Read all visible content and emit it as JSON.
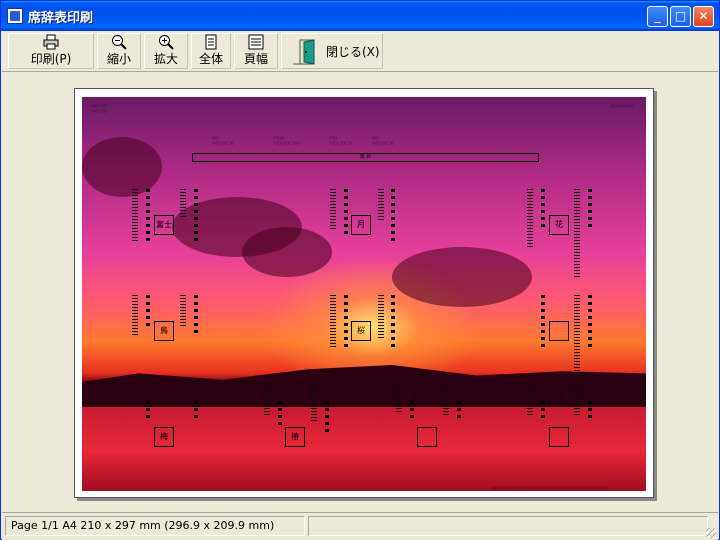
{
  "window": {
    "title": "席辞表印刷"
  },
  "titlebar": {
    "min_glyph": "_",
    "max_glyph": "□",
    "close_glyph": "✕"
  },
  "toolbar": {
    "print_label": "印刷(P)",
    "zoom_out_label": "縮小",
    "zoom_in_label": "拡大",
    "whole_label": "全体",
    "page_width_label": "頁幅",
    "close_label": "閉じる(X)",
    "print_icon": "printer-icon",
    "zoom_out_icon": "magnifier-minus-icon",
    "zoom_in_icon": "magnifier-plus-icon",
    "whole_icon": "page-icon",
    "page_width_icon": "page-lines-icon",
    "close_icon": "door-exit-icon"
  },
  "preview": {
    "head_table_label": "高 砂",
    "tables": [
      {
        "name": "富士"
      },
      {
        "name": "月"
      },
      {
        "name": "花"
      },
      {
        "name": "鳥"
      },
      {
        "name": "桜"
      },
      {
        "name": ""
      },
      {
        "name": "梅"
      },
      {
        "name": "椿"
      },
      {
        "name": ""
      },
      {
        "name": ""
      }
    ]
  },
  "statusbar": {
    "text": "Page 1/1  A4 210 x 297 mm (296.9 x 209.9 mm)"
  }
}
